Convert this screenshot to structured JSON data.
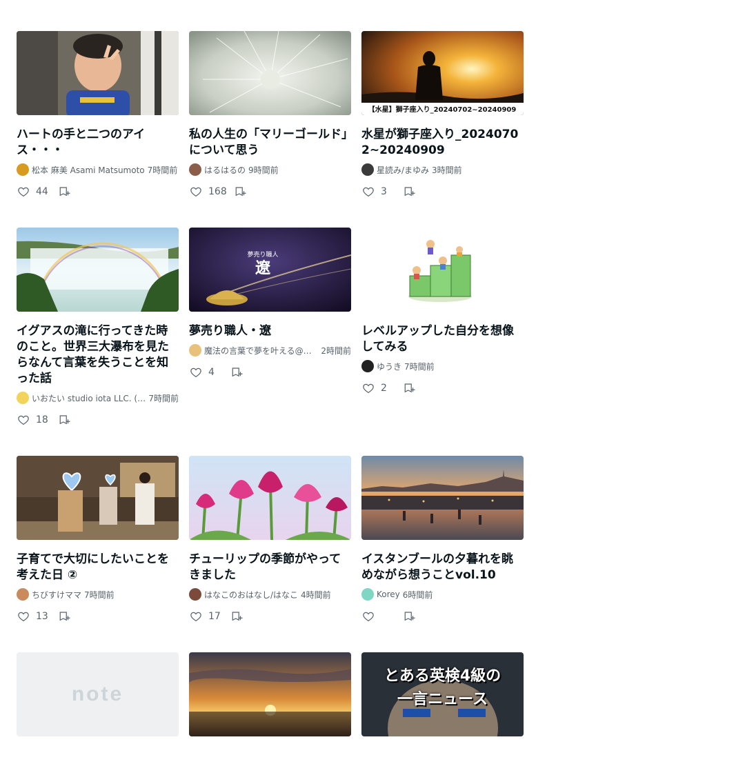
{
  "cards": [
    {
      "title": "ハートの手と二つのアイス・・・",
      "author": "松本 麻美 Asami Matsumoto",
      "time": "7時間前",
      "likes": "44",
      "thumb": "boy-photo",
      "avatar_color": "#d69b1f"
    },
    {
      "title": "私の人生の「マリーゴールド」について思う",
      "author": "はるはるの",
      "time": "9時間前",
      "likes": "168",
      "thumb": "dandelion-photo",
      "avatar_color": "#8b5e4a"
    },
    {
      "title": "水星が獅子座入り_20240702~20240909",
      "author": "星読み/まゆみ",
      "time": "3時間前",
      "likes": "3",
      "thumb": "sunset-woman-photo",
      "thumb_caption": "【水星】獅子座入り_20240702~20240909",
      "avatar_color": "#3a3a3a"
    },
    {
      "title": "イグアスの滝に行ってきた時のこと。世界三大瀑布を見たらなんて言葉を失うことを知った話",
      "author": "いおたい studio iota LLC. (スタジオイオタ)",
      "time": "7時間前",
      "likes": "18",
      "thumb": "waterfall-photo",
      "avatar_color": "#f2d35c"
    },
    {
      "title": "夢売り職人・遼",
      "author": "魔法の言葉で夢を叶える@夢売り職人・遼",
      "time": "2時間前",
      "likes": "4",
      "thumb": "magic-lamp-image",
      "thumb_caption": "夢売り職人 遼",
      "avatar_color": "#e8c27a"
    },
    {
      "title": "レベルアップした自分を想像してみる",
      "author": "ゆうき",
      "time": "7時間前",
      "likes": "2",
      "thumb": "stairs-illustration",
      "avatar_color": "#222222"
    },
    {
      "title": "子育てで大切にしたいことを考えた日 ②",
      "author": "ちびすけママ",
      "time": "7時間前",
      "likes": "13",
      "thumb": "family-photo",
      "avatar_color": "#c98a5e"
    },
    {
      "title": "チューリップの季節がやってきました",
      "author": "はなこのおはなし/はなこ",
      "time": "4時間前",
      "likes": "17",
      "thumb": "tulip-photo",
      "avatar_color": "#7a4b3a"
    },
    {
      "title": "イスタンブールの夕暮れを眺めながら想うことvol.10",
      "author": "Korey",
      "time": "6時間前",
      "likes": "",
      "thumb": "istanbul-photo",
      "avatar_color": "#7fd6c2"
    },
    {
      "title": "",
      "author": "",
      "time": "",
      "likes": "",
      "thumb": "note-placeholder",
      "watermark": "note"
    },
    {
      "title": "",
      "author": "",
      "time": "",
      "likes": "",
      "thumb": "sea-sunset-photo"
    },
    {
      "title": "",
      "author": "",
      "time": "",
      "likes": "",
      "thumb": "news-thumbnail",
      "thumb_caption": "とある英検4級の\n一言ニュース"
    }
  ],
  "icons": {
    "like": "heart-outline-icon",
    "save": "bookmark-plus-icon"
  },
  "colors": {
    "text": "#08131a",
    "muted": "#57616a"
  }
}
